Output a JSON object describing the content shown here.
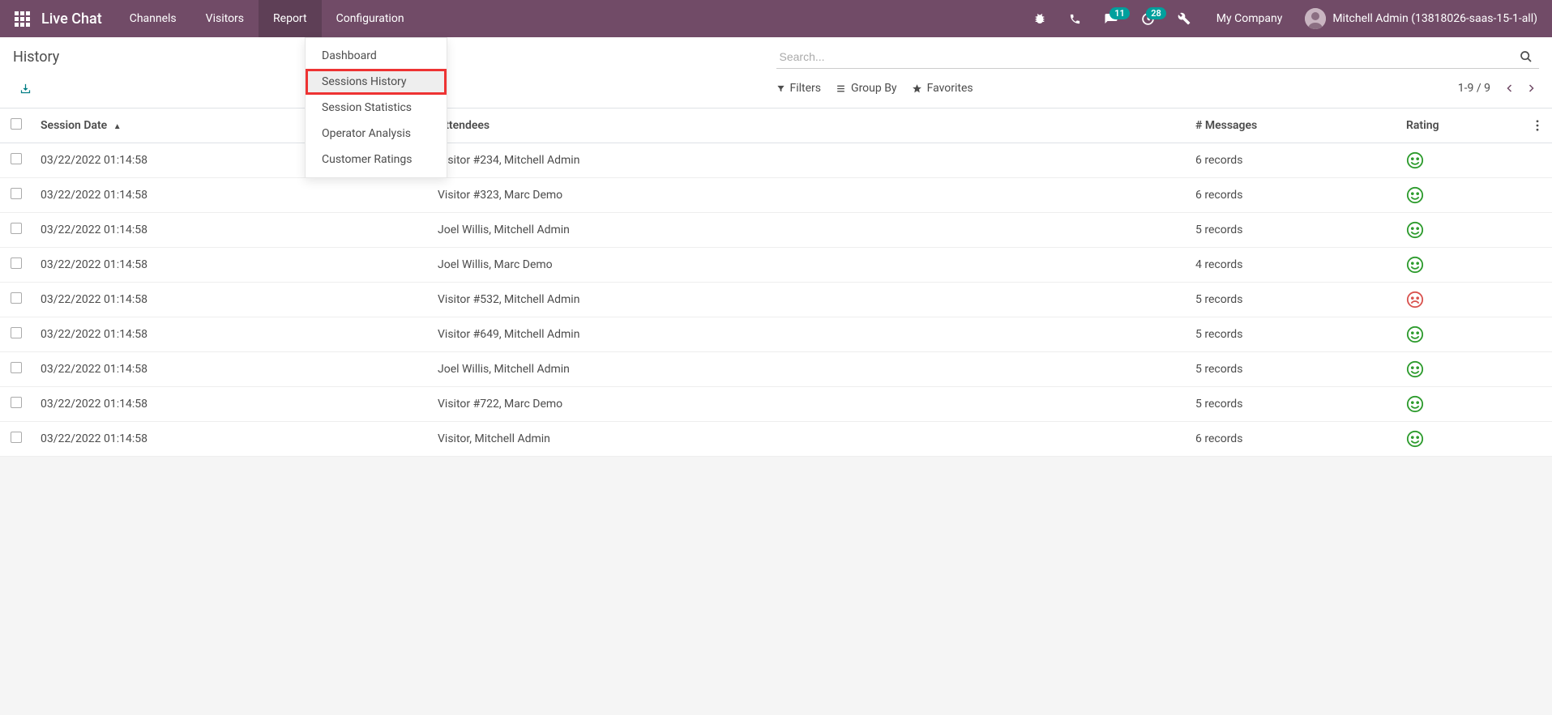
{
  "navbar": {
    "brand": "Live Chat",
    "items": [
      "Channels",
      "Visitors",
      "Report",
      "Configuration"
    ],
    "active_index": 2,
    "msg_badge": "11",
    "activity_badge": "28",
    "company": "My Company",
    "user": "Mitchell Admin (13818026-saas-15-1-all)"
  },
  "dropdown": {
    "items": [
      "Dashboard",
      "Sessions History",
      "Session Statistics",
      "Operator Analysis",
      "Customer Ratings"
    ],
    "highlighted_index": 1
  },
  "breadcrumb": "History",
  "search": {
    "placeholder": "Search..."
  },
  "toolbar": {
    "filters": "Filters",
    "groupby": "Group By",
    "favorites": "Favorites",
    "pager": "1-9 / 9"
  },
  "columns": {
    "session_date": "Session Date",
    "attendees": "Attendees",
    "messages": "# Messages",
    "rating": "Rating"
  },
  "rows": [
    {
      "date": "03/22/2022 01:14:58",
      "attendees": "Visitor #234, Mitchell Admin",
      "messages": "6 records",
      "rating": "happy"
    },
    {
      "date": "03/22/2022 01:14:58",
      "attendees": "Visitor #323, Marc Demo",
      "messages": "6 records",
      "rating": "happy"
    },
    {
      "date": "03/22/2022 01:14:58",
      "attendees": "Joel Willis, Mitchell Admin",
      "messages": "5 records",
      "rating": "happy"
    },
    {
      "date": "03/22/2022 01:14:58",
      "attendees": "Joel Willis, Marc Demo",
      "messages": "4 records",
      "rating": "happy"
    },
    {
      "date": "03/22/2022 01:14:58",
      "attendees": "Visitor #532, Mitchell Admin",
      "messages": "5 records",
      "rating": "sad"
    },
    {
      "date": "03/22/2022 01:14:58",
      "attendees": "Visitor #649, Mitchell Admin",
      "messages": "5 records",
      "rating": "happy"
    },
    {
      "date": "03/22/2022 01:14:58",
      "attendees": "Joel Willis, Mitchell Admin",
      "messages": "5 records",
      "rating": "happy"
    },
    {
      "date": "03/22/2022 01:14:58",
      "attendees": "Visitor #722, Marc Demo",
      "messages": "5 records",
      "rating": "happy"
    },
    {
      "date": "03/22/2022 01:14:58",
      "attendees": "Visitor, Mitchell Admin",
      "messages": "6 records",
      "rating": "happy"
    }
  ]
}
